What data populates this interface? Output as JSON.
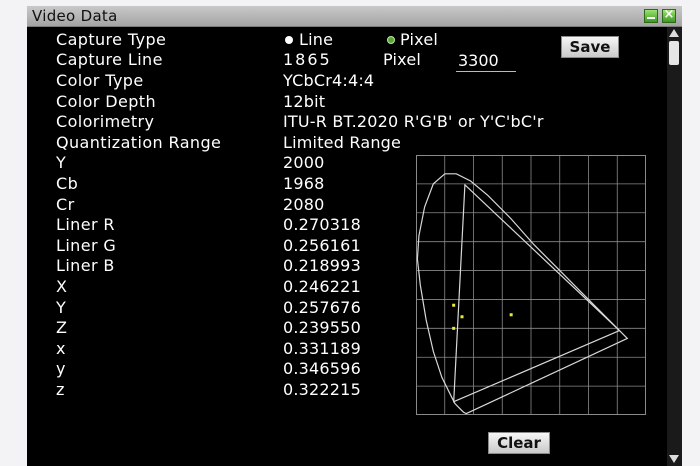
{
  "window": {
    "title": "Video Data"
  },
  "capture": {
    "type_label": "Capture Type",
    "option_line": "Line",
    "option_pixel": "Pixel",
    "selected": "Line",
    "line_label": "Capture Line",
    "line_value": "1865",
    "pixel_label": "Pixel",
    "pixel_value": "3300"
  },
  "buttons": {
    "save": "Save",
    "clear": "Clear"
  },
  "rows": [
    {
      "label": "Color Type",
      "value": "YCbCr4:4:4"
    },
    {
      "label": "Color Depth",
      "value": "12bit"
    },
    {
      "label": "Colorimetry",
      "value": "ITU-R BT.2020 R'G'B' or Y'C'bC'r"
    },
    {
      "label": "Quantization Range",
      "value": "Limited Range"
    },
    {
      "label": "Y",
      "value": "2000"
    },
    {
      "label": "Cb",
      "value": "1968"
    },
    {
      "label": "Cr",
      "value": "2080"
    },
    {
      "label": "Liner R",
      "value": "0.270318"
    },
    {
      "label": "Liner G",
      "value": "0.256161"
    },
    {
      "label": "Liner B",
      "value": "0.218993"
    },
    {
      "label": "X",
      "value": "0.246221"
    },
    {
      "label": "Y",
      "value": "0.257676"
    },
    {
      "label": "Z",
      "value": "0.239550"
    },
    {
      "label": "x",
      "value": "0.331189"
    },
    {
      "label": "y",
      "value": "0.346596"
    },
    {
      "label": "z",
      "value": "0.322215"
    }
  ],
  "colors": {
    "window_bg": "#000000",
    "text": "#ffffff",
    "grid": "#8a8a8a",
    "locus": "#d8d8d8",
    "marker": "#e8ea3a",
    "radio_selected": "#ffffff",
    "radio_unselected": "#5aa53a"
  },
  "chart_data": {
    "type": "scatter",
    "grid": true,
    "xlim": [
      0,
      0.8
    ],
    "ylim": [
      0,
      0.9
    ],
    "gamut_triangle": [
      [
        0.708,
        0.292
      ],
      [
        0.17,
        0.797
      ],
      [
        0.131,
        0.046
      ]
    ],
    "points": [
      {
        "x": 0.131,
        "y": 0.38
      },
      {
        "x": 0.16,
        "y": 0.34
      },
      {
        "x": 0.131,
        "y": 0.3
      },
      {
        "x": 0.331,
        "y": 0.347
      }
    ]
  }
}
